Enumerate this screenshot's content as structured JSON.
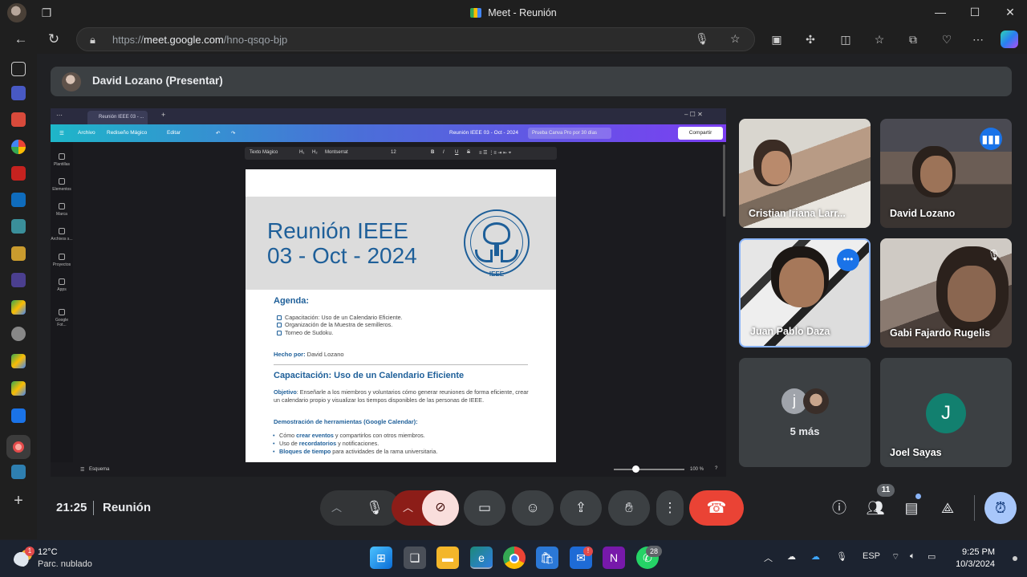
{
  "window": {
    "title": "Meet - Reunión",
    "minimize": "—",
    "maximize": "☐",
    "close": "✕"
  },
  "address_bar": {
    "url_scheme": "https://",
    "url_host": "meet.google.com",
    "url_path": "/hno-qsqo-bjp"
  },
  "presenter": {
    "label": "David Lozano (Presentar)"
  },
  "shared_screen": {
    "tab_title": "Reunión IEEE 03 - ...",
    "menu": {
      "file": "Archivo",
      "magic": "Rediseño Mágico",
      "edit": "Editar"
    },
    "doc_name": "Reunión IEEE 03 - Oct - 2024",
    "pro_trial": "Prueba Canva Pro por 30 días",
    "share": "Compartir",
    "rail": [
      "Plantillas",
      "Elementos",
      "Marca",
      "Archivos s...",
      "Proyectos",
      "Apps",
      "Google Fot..."
    ],
    "toolbar": {
      "magic_text": "Texto Mágico",
      "h1": "H₁",
      "h2": "H₂",
      "font": "Montserrat",
      "size": "12",
      "bold": "B",
      "italic": "I",
      "underline": "U",
      "strike": "S"
    },
    "status": {
      "outline": "Esquema",
      "zoom": "100 %"
    },
    "doc": {
      "title_line1": "Reunión IEEE",
      "title_line2": "03 - Oct - 2024",
      "logo_text": "IEEE",
      "agenda_heading": "Agenda:",
      "agenda_items": [
        "Capacitación: Uso de un Calendario Eficiente.",
        "Organización de la Muestra de semilleros.",
        "Torneo de Sudoku."
      ],
      "made_by_label": "Hecho por:",
      "made_by_name": " David Lozano",
      "section_heading": "Capacitación: Uso de un Calendario Eficiente",
      "objective_label": "Objetivo",
      "objective_text": ": Enseñarle a los miembros y voluntarios cómo generar reuniones de forma eficiente, crear un calendario propio y visualizar los tiempos disponibles de las personas de IEEE.",
      "demo_heading": "Demostración de herramientas (Google Calendar):",
      "bullets": [
        {
          "pre": "Cómo ",
          "bold": "crear eventos",
          "post": " y compartirlos con otros miembros."
        },
        {
          "pre": "Uso de ",
          "bold": "recordatorios",
          "post": " y notificaciones."
        },
        {
          "pre": "",
          "bold": "Bloques de tiempo",
          "post": " para actividades de la rama universitaria."
        }
      ]
    }
  },
  "participants": [
    {
      "name": "Cristian Iriana Larr..."
    },
    {
      "name": "David Lozano",
      "speaking": true
    },
    {
      "name": "Juan Pablo Daza",
      "active": true
    },
    {
      "name": "Gabi Fajardo Rugelis",
      "muted": true
    },
    {
      "name": "5 más",
      "avatar_letter": "j"
    },
    {
      "name": "Joel Sayas",
      "avatar_letter": "J"
    }
  ],
  "controls": {
    "time": "21:25",
    "meeting": "Reunión",
    "participant_count": "11",
    "end_call": "end-call-icon"
  },
  "taskbar": {
    "temperature": "12°C",
    "condition": "Parc. nublado",
    "weather_badge": "1",
    "whatsapp_badge": "28",
    "lang": "ESP",
    "time": "9:25 PM",
    "date": "10/3/2024"
  },
  "colors": {
    "accent": "#1a73e8",
    "end_call": "#ea4335",
    "doc_blue": "#1e5f99",
    "camera_off": "#8c1d18"
  }
}
